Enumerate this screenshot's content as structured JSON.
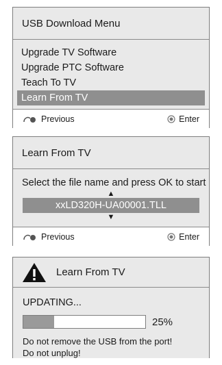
{
  "panel1": {
    "title": "USB Download Menu",
    "items": [
      {
        "label": "Upgrade TV Software",
        "selected": false
      },
      {
        "label": "Upgrade PTC Software",
        "selected": false
      },
      {
        "label": "Teach To TV",
        "selected": false
      },
      {
        "label": "Learn From TV",
        "selected": true
      }
    ],
    "footer": {
      "previous": "Previous",
      "enter": "Enter"
    }
  },
  "panel2": {
    "title": "Learn From TV",
    "instruction": "Select the file name and press OK to start",
    "up_arrow": "▲",
    "down_arrow": "▼",
    "filename": "xxLD320H-UA00001.TLL",
    "footer": {
      "previous": "Previous",
      "enter": "Enter"
    }
  },
  "panel3": {
    "title": "Learn From TV",
    "status": "UPDATING...",
    "progress_percent": 25,
    "progress_text": "25%",
    "messages": [
      "Do not remove the USB from the port!",
      "Do not unplug!"
    ]
  },
  "icons": {
    "previous": "back-swirl-icon",
    "enter": "ok-circle-icon",
    "warning": "warning-triangle-icon"
  },
  "colors": {
    "selection": "#8f8f8f",
    "panel_bg": "#e9e9e9",
    "progress_fill": "#9a9a9a"
  }
}
